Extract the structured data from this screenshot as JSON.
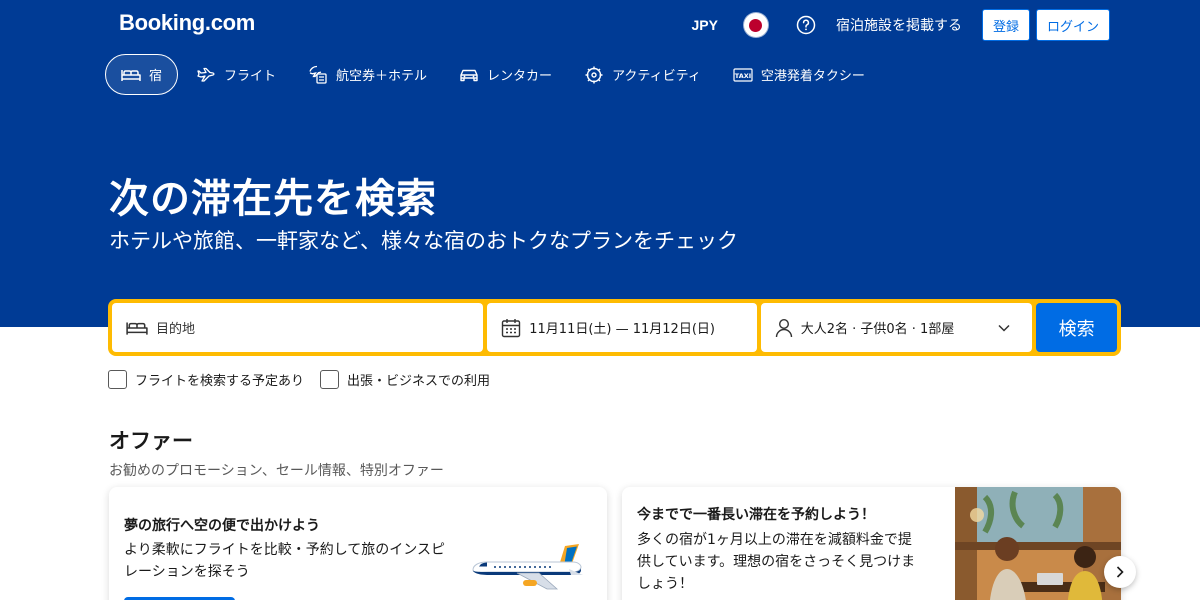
{
  "header": {
    "logo": "Booking.com",
    "currency": "JPY",
    "list_property": "宿泊施設を掲載する",
    "register": "登録",
    "login": "ログイン"
  },
  "tabs": [
    {
      "label": "宿",
      "icon": "bed-icon",
      "active": true
    },
    {
      "label": "フライト",
      "icon": "plane-icon",
      "active": false
    },
    {
      "label": "航空券＋ホテル",
      "icon": "flight-hotel-icon",
      "active": false
    },
    {
      "label": "レンタカー",
      "icon": "car-icon",
      "active": false
    },
    {
      "label": "アクティビティ",
      "icon": "attractions-icon",
      "active": false
    },
    {
      "label": "空港発着タクシー",
      "icon": "taxi-icon",
      "active": false
    }
  ],
  "hero": {
    "title": "次の滞在先を検索",
    "subtitle": "ホテルや旅館、一軒家など、様々な宿のおトクなプランをチェック"
  },
  "search": {
    "destination_placeholder": "目的地",
    "dates": "11月11日(土) — 11月12日(日)",
    "guests": "大人2名 · 子供0名 · 1部屋",
    "button": "検索"
  },
  "checkboxes": [
    {
      "label": "フライトを検索する予定あり",
      "checked": false
    },
    {
      "label": "出張・ビジネスでの利用",
      "checked": false
    }
  ],
  "offers": {
    "title": "オファー",
    "subtitle": "お勧めのプロモーション、セール情報、特別オファー",
    "cards": [
      {
        "title": "夢の旅行へ空の便で出かけよう",
        "text": "より柔軟にフライトを比較・予約して旅のインスピレーションを探そう"
      },
      {
        "title": "今までで一番長い滞在を予約しよう！",
        "text": "多くの宿が1ヶ月以上の滞在を減額料金で提供しています。理想の宿をさっそく見つけましょう！"
      }
    ]
  },
  "colors": {
    "brand_blue": "#003b95",
    "accent_blue": "#006ce4",
    "search_border": "#febb02"
  }
}
